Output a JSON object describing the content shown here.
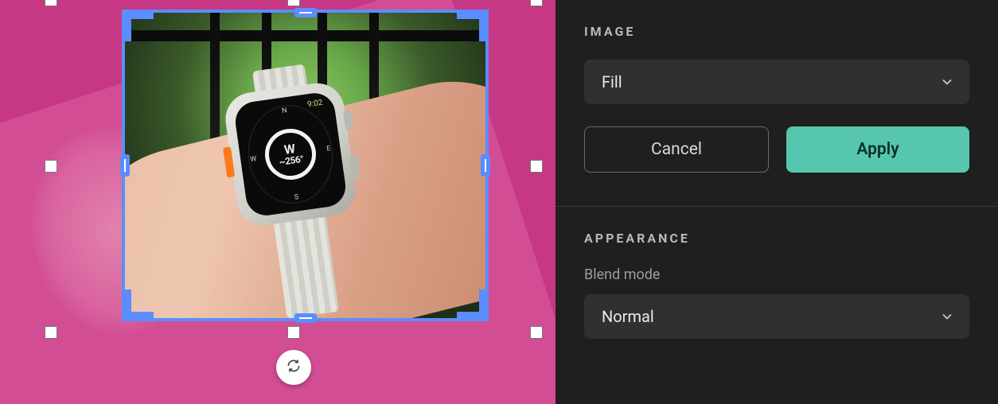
{
  "canvas": {
    "bg_color": "#c63884",
    "accent_color": "#5b8dff",
    "refresh_tooltip": "Reset crop"
  },
  "watch": {
    "time": "9:02",
    "heading_dir": "W",
    "heading_deg": "~256°",
    "cardinal_n": "N",
    "cardinal_s": "S",
    "cardinal_e": "E",
    "cardinal_w": "W"
  },
  "panel": {
    "image_section_title": "IMAGE",
    "fill_mode_value": "Fill",
    "cancel_label": "Cancel",
    "apply_label": "Apply",
    "appearance_section_title": "APPEARANCE",
    "blend_mode_label": "Blend mode",
    "blend_mode_value": "Normal",
    "apply_color": "#56c7ae"
  }
}
